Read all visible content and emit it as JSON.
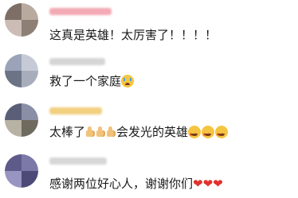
{
  "comments": [
    {
      "text": "这真是英雄！太厉害了！！！！",
      "emoji": []
    },
    {
      "text": "救了一个家庭",
      "emoji": [
        "crying-face"
      ]
    },
    {
      "text_before": "太棒了",
      "text_after": "会发光的英雄",
      "emoji_mid": [
        "thumbs-up",
        "thumbs-up",
        "thumbs-up"
      ],
      "emoji_end": [
        "star-struck-face",
        "star-struck-face",
        "star-struck-face"
      ]
    },
    {
      "text": "感谢两位好心人，谢谢你们",
      "emoji": [
        "red-heart",
        "red-heart",
        "red-heart"
      ],
      "heart_glyph": "❤"
    }
  ],
  "colors": {
    "text": "#1a1a1a",
    "heart": "#e0322d"
  }
}
